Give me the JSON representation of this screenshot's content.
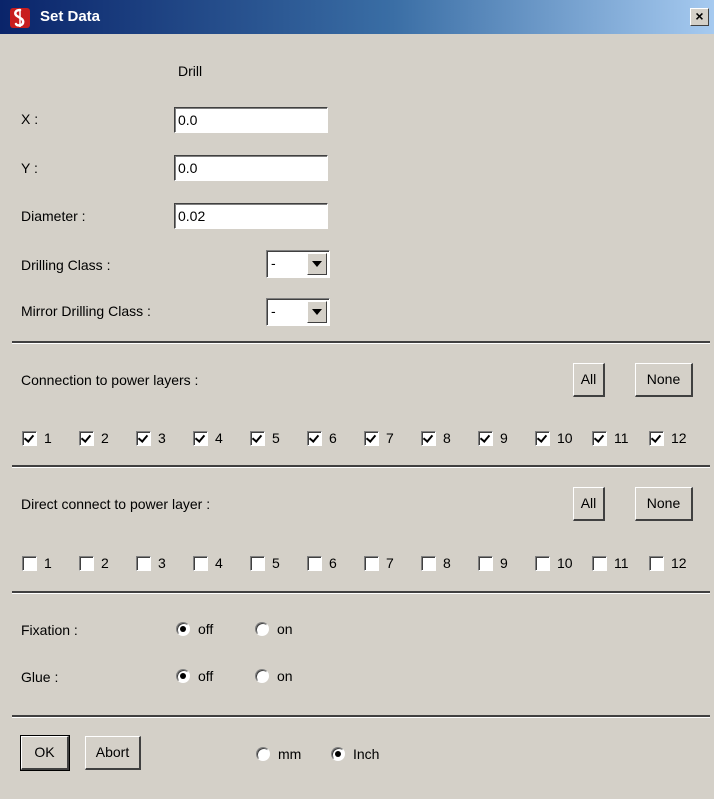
{
  "window": {
    "title": "Set Data",
    "close_glyph": "×"
  },
  "header": {
    "object_type": "Drill"
  },
  "fields": {
    "x": {
      "label": "X :",
      "value": "0.0"
    },
    "y": {
      "label": "Y :",
      "value": "0.0"
    },
    "diameter": {
      "label": "Diameter :",
      "value": "0.02"
    },
    "drilling_class": {
      "label": "Drilling Class :",
      "value": "-"
    },
    "mirror_drilling_class": {
      "label": "Mirror Drilling Class :",
      "value": "-"
    }
  },
  "power_layers": {
    "label": "Connection to power layers :",
    "all_label": "All",
    "none_label": "None",
    "layers": [
      {
        "label": "1",
        "checked": true
      },
      {
        "label": "2",
        "checked": true
      },
      {
        "label": "3",
        "checked": true
      },
      {
        "label": "4",
        "checked": true
      },
      {
        "label": "5",
        "checked": true
      },
      {
        "label": "6",
        "checked": true
      },
      {
        "label": "7",
        "checked": true
      },
      {
        "label": "8",
        "checked": true
      },
      {
        "label": "9",
        "checked": true
      },
      {
        "label": "10",
        "checked": true
      },
      {
        "label": "11",
        "checked": true
      },
      {
        "label": "12",
        "checked": true
      }
    ]
  },
  "direct_connect": {
    "label": "Direct connect to power layer :",
    "all_label": "All",
    "none_label": "None",
    "layers": [
      {
        "label": "1",
        "checked": false
      },
      {
        "label": "2",
        "checked": false
      },
      {
        "label": "3",
        "checked": false
      },
      {
        "label": "4",
        "checked": false
      },
      {
        "label": "5",
        "checked": false
      },
      {
        "label": "6",
        "checked": false
      },
      {
        "label": "7",
        "checked": false
      },
      {
        "label": "8",
        "checked": false
      },
      {
        "label": "9",
        "checked": false
      },
      {
        "label": "10",
        "checked": false
      },
      {
        "label": "11",
        "checked": false
      },
      {
        "label": "12",
        "checked": false
      }
    ]
  },
  "fixation": {
    "label": "Fixation :",
    "off_label": "off",
    "on_label": "on",
    "selected": "off"
  },
  "glue": {
    "label": "Glue :",
    "off_label": "off",
    "on_label": "on",
    "selected": "off"
  },
  "footer": {
    "ok_label": "OK",
    "abort_label": "Abort",
    "unit_mm_label": "mm",
    "unit_inch_label": "Inch",
    "unit_selected": "Inch"
  }
}
